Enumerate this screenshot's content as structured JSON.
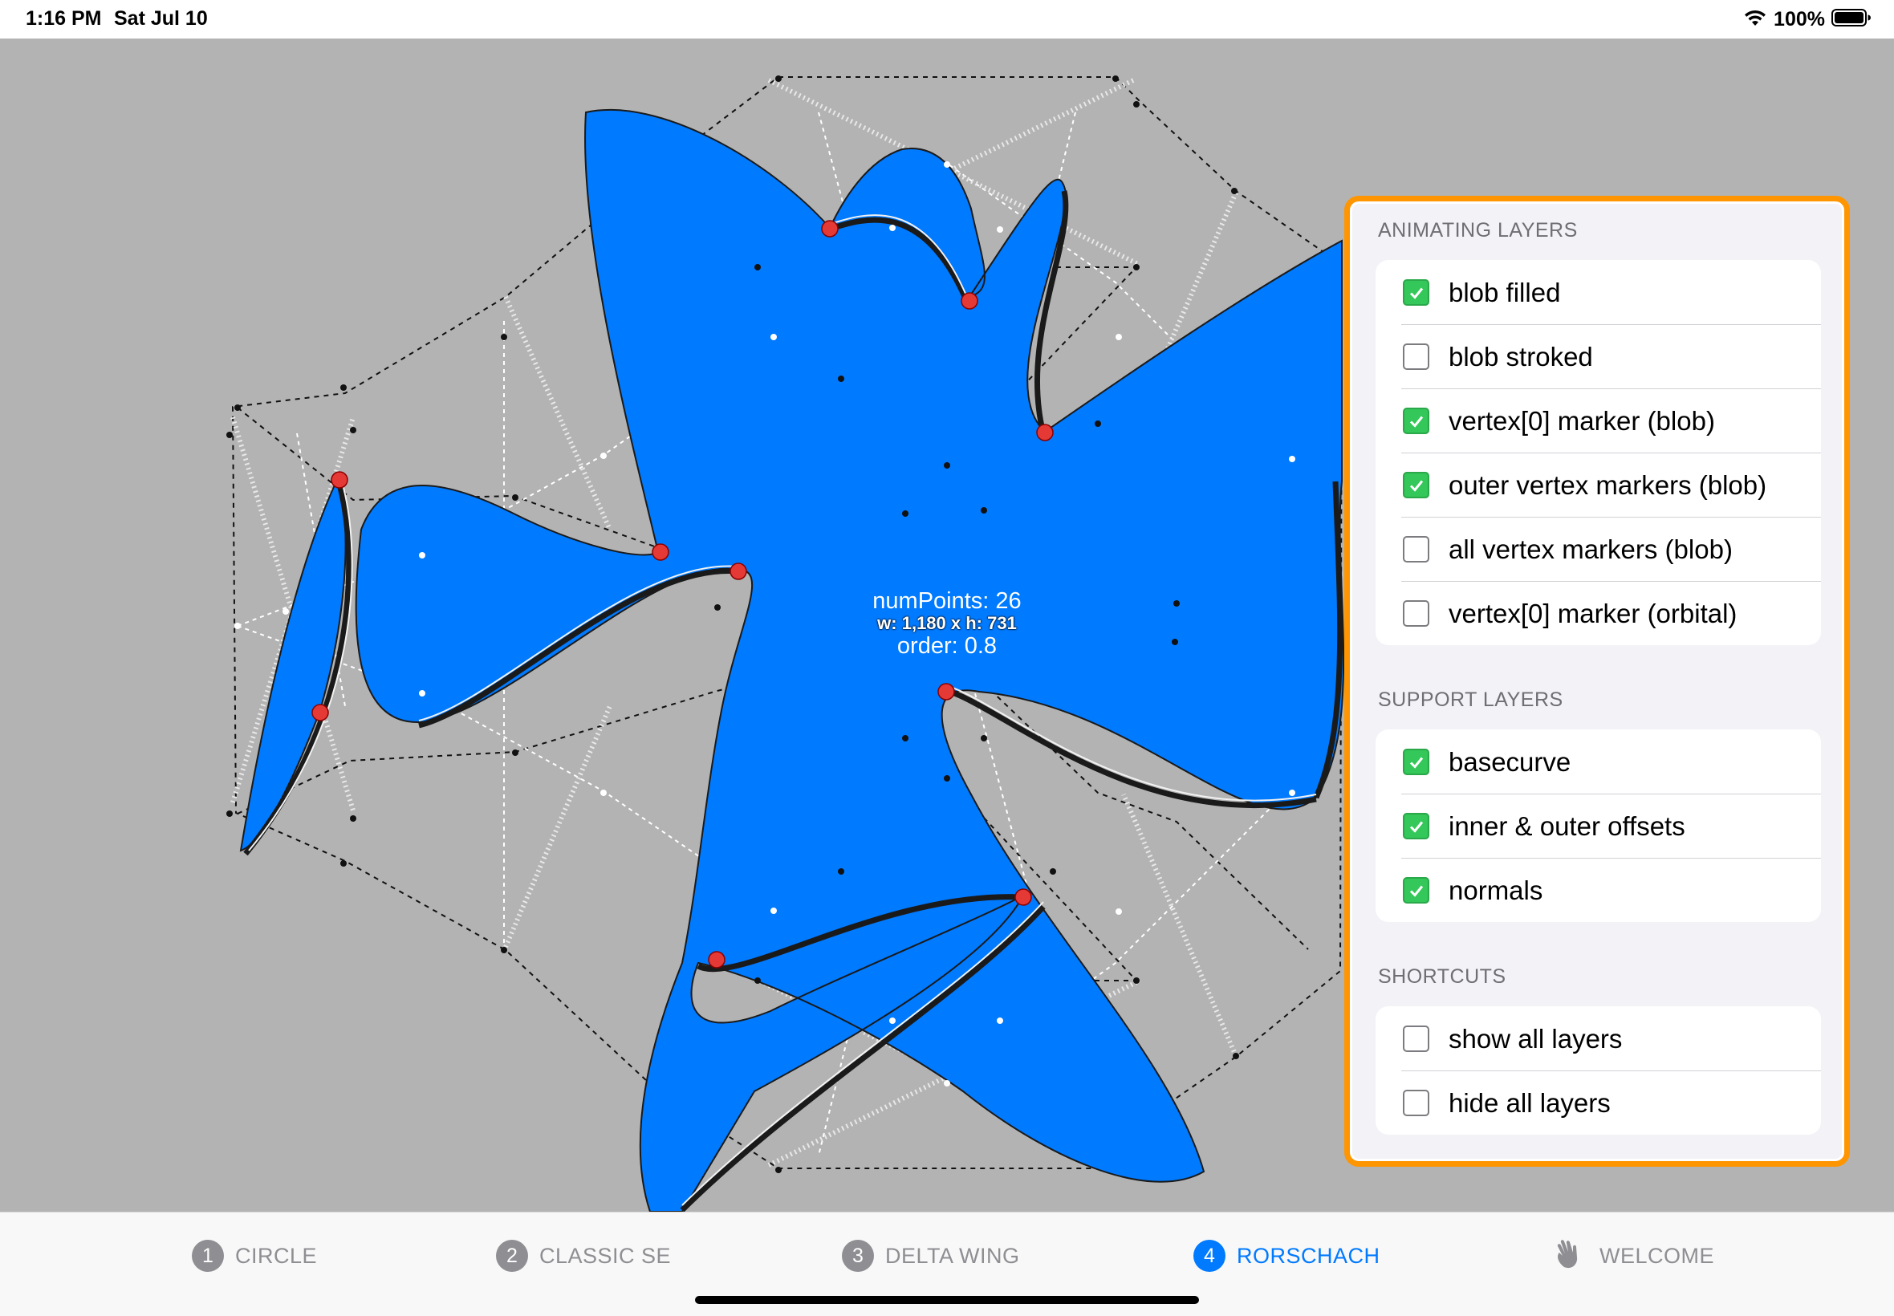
{
  "status_bar": {
    "time": "1:16 PM",
    "date": "Sat Jul 10",
    "battery": "100%",
    "icons": [
      "wifi-icon",
      "battery-icon"
    ]
  },
  "canvas": {
    "background": "#b3b3b3",
    "blob_color": "#007aff",
    "marker_color": "#e53935",
    "info": {
      "num_points": "numPoints: 26",
      "size": "w: 1,180 x h: 731",
      "order": "order: 0.8"
    }
  },
  "panel": {
    "accent": "#ff9500",
    "sections": [
      {
        "header": "ANIMATING LAYERS",
        "items": [
          {
            "label": "blob filled",
            "checked": true
          },
          {
            "label": "blob stroked",
            "checked": false
          },
          {
            "label": "vertex[0] marker (blob)",
            "checked": true
          },
          {
            "label": "outer vertex markers (blob)",
            "checked": true
          },
          {
            "label": "all vertex markers (blob)",
            "checked": false
          },
          {
            "label": "vertex[0] marker (orbital)",
            "checked": false
          }
        ]
      },
      {
        "header": "SUPPORT LAYERS",
        "items": [
          {
            "label": "basecurve",
            "checked": true
          },
          {
            "label": "inner & outer offsets",
            "checked": true
          },
          {
            "label": "normals",
            "checked": true
          }
        ]
      },
      {
        "header": "SHORTCUTS",
        "items": [
          {
            "label": "show all layers",
            "checked": false
          },
          {
            "label": "hide all layers",
            "checked": false
          }
        ]
      }
    ]
  },
  "tab_bar": {
    "active_color": "#007aff",
    "tabs": [
      {
        "number": "1",
        "label": "CIRCLE",
        "active": false
      },
      {
        "number": "2",
        "label": "CLASSIC SE",
        "active": false
      },
      {
        "number": "3",
        "label": "DELTA WING",
        "active": false
      },
      {
        "number": "4",
        "label": "RORSCHACH",
        "active": true
      },
      {
        "icon": "hand-wave-icon",
        "label": "WELCOME",
        "active": false
      }
    ]
  }
}
